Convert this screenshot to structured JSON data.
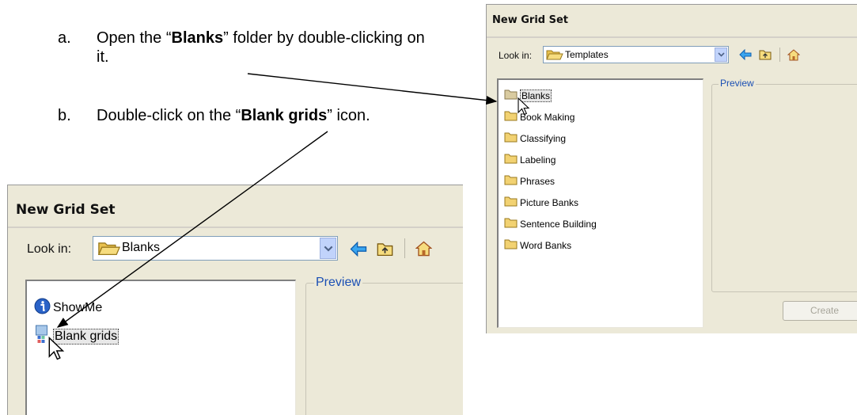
{
  "instructions": {
    "a_label": "a.",
    "a_pre": "Open the “",
    "a_bold": "Blanks",
    "a_post": "” folder by double-clicking on it.",
    "b_label": "b.",
    "b_pre": "Double-click on the “",
    "b_bold": "Blank grids",
    "b_post": "” icon."
  },
  "dialog_templates": {
    "title": "New Grid Set",
    "look_in_label": "Look in:",
    "look_in_value": "Templates",
    "preview_label": "Preview",
    "create_label": "Create",
    "items": [
      {
        "label": "Blanks",
        "selected": true
      },
      {
        "label": "Book Making"
      },
      {
        "label": "Classifying"
      },
      {
        "label": "Labeling"
      },
      {
        "label": "Phrases"
      },
      {
        "label": "Picture Banks"
      },
      {
        "label": "Sentence Building"
      },
      {
        "label": "Word Banks"
      }
    ]
  },
  "dialog_blanks": {
    "title": "New Grid Set",
    "look_in_label": "Look in:",
    "look_in_value": "Blanks",
    "preview_label": "Preview",
    "items": [
      {
        "label": "ShowMe",
        "icon": "info-icon"
      },
      {
        "label": "Blank grids",
        "icon": "grid-file-icon",
        "selected": true
      }
    ]
  },
  "colors": {
    "dialog_bg": "#ece9d8",
    "folder_yellow": "#f2d272",
    "preview_label": "#1a4fb4",
    "back_arrow": "#1e90ff"
  }
}
